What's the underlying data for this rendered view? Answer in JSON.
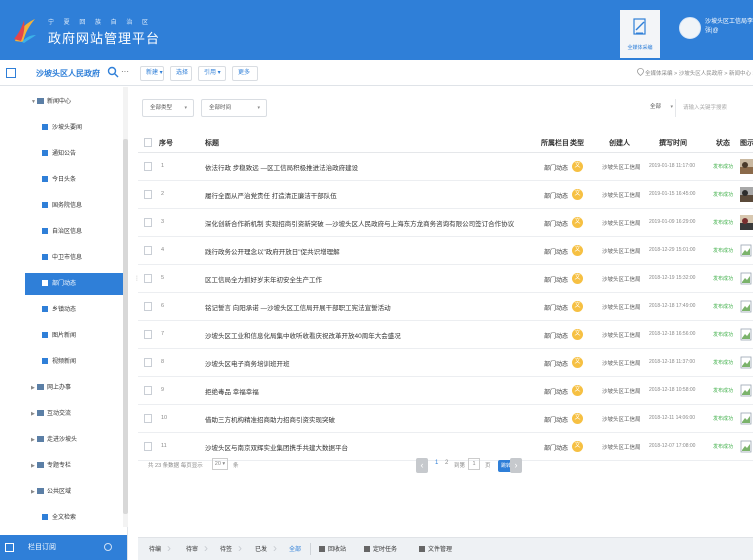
{
  "header": {
    "brand_top": "宁 夏 回 族 自 治 区",
    "brand_main": "政府网站管理平台",
    "collect_label": "全媒体采编",
    "user_line1": "沙坡头区工信局李子编",
    "user_line2": "张|@"
  },
  "subbar": {
    "site_name": "沙坡头区人民政府",
    "more": "···",
    "toolbar": {
      "new": "新建 ▾",
      "select": "选择",
      "cite": "引用 ▾",
      "more": "更多"
    },
    "breadcrumb": "全媒体采编 > 沙坡头区人民政府 > 新闻中心 > 部门"
  },
  "sidebar": {
    "news_center": "新闻中心",
    "children": [
      {
        "label": "沙坡头要闻",
        "active": false
      },
      {
        "label": "通知公告",
        "active": false
      },
      {
        "label": "今日头条",
        "active": false
      },
      {
        "label": "国务院信息",
        "active": false
      },
      {
        "label": "自治区信息",
        "active": false
      },
      {
        "label": "中卫市信息",
        "active": false
      },
      {
        "label": "部门动态",
        "active": true
      },
      {
        "label": "乡镇动态",
        "active": false
      },
      {
        "label": "图片新闻",
        "active": false
      },
      {
        "label": "视频新闻",
        "active": false
      }
    ],
    "parents": [
      "网上办事",
      "互动交流",
      "走进沙坡头",
      "专题专栏",
      "公共区域"
    ],
    "full_text": "全文检索",
    "footer_label": "栏目订阅"
  },
  "filters": {
    "type": "全部类型",
    "time": "全部时间",
    "scope": "全部",
    "search_placeholder": "请输入关键字搜索"
  },
  "table": {
    "headers": {
      "no": "序号",
      "title": "标题",
      "column": "所属栏目",
      "type": "类型",
      "creator": "创建人",
      "time": "撰写时间",
      "status": "状态",
      "image": "图示"
    },
    "rows": [
      {
        "no": "1",
        "title": "依法行政 步稳致远 —区工信局积极推进法治政府建设",
        "column": "部门动态",
        "type": "文",
        "creator": "沙坡头区工信局",
        "time": "2019-01-18 11:17:00",
        "status": "发布成功",
        "image": "photo-1"
      },
      {
        "no": "2",
        "title": "履行全面从严治党责任 打造清正廉洁干部队伍",
        "column": "部门动态",
        "type": "文",
        "creator": "沙坡头区工信局",
        "time": "2019-01-15 16:45:00",
        "status": "发布成功",
        "image": "photo-2"
      },
      {
        "no": "3",
        "title": "深化创新合作新机制 实现招商引资新突破 —沙坡头区人民政府与上海东方龙商务咨询有限公司签订合作协议",
        "column": "部门动态",
        "type": "文",
        "creator": "沙坡头区工信局",
        "time": "2019-01-09 16:29:00",
        "status": "发布成功",
        "image": "photo-3"
      },
      {
        "no": "4",
        "title": "践行政务公开理念以\"政府开放日\"促共识增理解",
        "column": "部门动态",
        "type": "文",
        "creator": "沙坡头区工信局",
        "time": "2018-12-29 15:01:00",
        "status": "发布成功",
        "image": "broken"
      },
      {
        "no": "5",
        "title": "区工信局全力抓好岁末年初安全生产工作",
        "column": "部门动态",
        "type": "文",
        "creator": "沙坡头区工信局",
        "time": "2018-12-19 15:32:00",
        "status": "发布成功",
        "image": "broken"
      },
      {
        "no": "6",
        "title": "铭记誓言 向阳承诺 —沙坡头区工信局开展干部职工宪法宣誓活动",
        "column": "部门动态",
        "type": "文",
        "creator": "沙坡头区工信局",
        "time": "2018-12-18 17:49:00",
        "status": "发布成功",
        "image": "broken"
      },
      {
        "no": "7",
        "title": "沙坡头区工业和信息化局集中收听收看庆祝改革开放40周年大会盛况",
        "column": "部门动态",
        "type": "文",
        "creator": "沙坡头区工信局",
        "time": "2018-12-18 16:56:00",
        "status": "发布成功",
        "image": "broken"
      },
      {
        "no": "8",
        "title": "沙坡头区电子商务培训班开班",
        "column": "部门动态",
        "type": "文",
        "creator": "沙坡头区工信局",
        "time": "2018-12-18 11:37:00",
        "status": "发布成功",
        "image": "broken"
      },
      {
        "no": "9",
        "title": "拒绝毒品 幸福幸福",
        "column": "部门动态",
        "type": "文",
        "creator": "沙坡头区工信局",
        "time": "2018-12-18 10:58:00",
        "status": "发布成功",
        "image": "broken"
      },
      {
        "no": "10",
        "title": "借助三方机构精准招商助力招商引资实现突破",
        "column": "部门动态",
        "type": "文",
        "creator": "沙坡头区工信局",
        "time": "2018-12-11 14:06:00",
        "status": "发布成功",
        "image": "broken"
      },
      {
        "no": "11",
        "title": "沙坡头区与南京双辉实业集团携手共建大数据平台",
        "column": "部门动态",
        "type": "文",
        "creator": "沙坡头区工信局",
        "time": "2018-12-07 17:08:00",
        "status": "发布成功",
        "image": "broken"
      }
    ]
  },
  "pagination": {
    "summary": "共 23 条数据  每页显示",
    "page_size": "20 ▾",
    "unit": "条",
    "page1": "1",
    "page2": "2",
    "goto_prefix": "到第",
    "goto_value": "1",
    "goto_suffix": "页",
    "go": "跳转",
    "prev": "‹",
    "next": "›"
  },
  "bottom_tabs": {
    "items": [
      "待编",
      "待审",
      "待签",
      "已发",
      "全部"
    ],
    "recycle": "回收站",
    "scheduled": "定时任务",
    "file_mgmt": "文件管理"
  },
  "colors": {
    "primary": "#2f7fd8",
    "success": "#43b14d",
    "type_badge": "#f6c042"
  }
}
